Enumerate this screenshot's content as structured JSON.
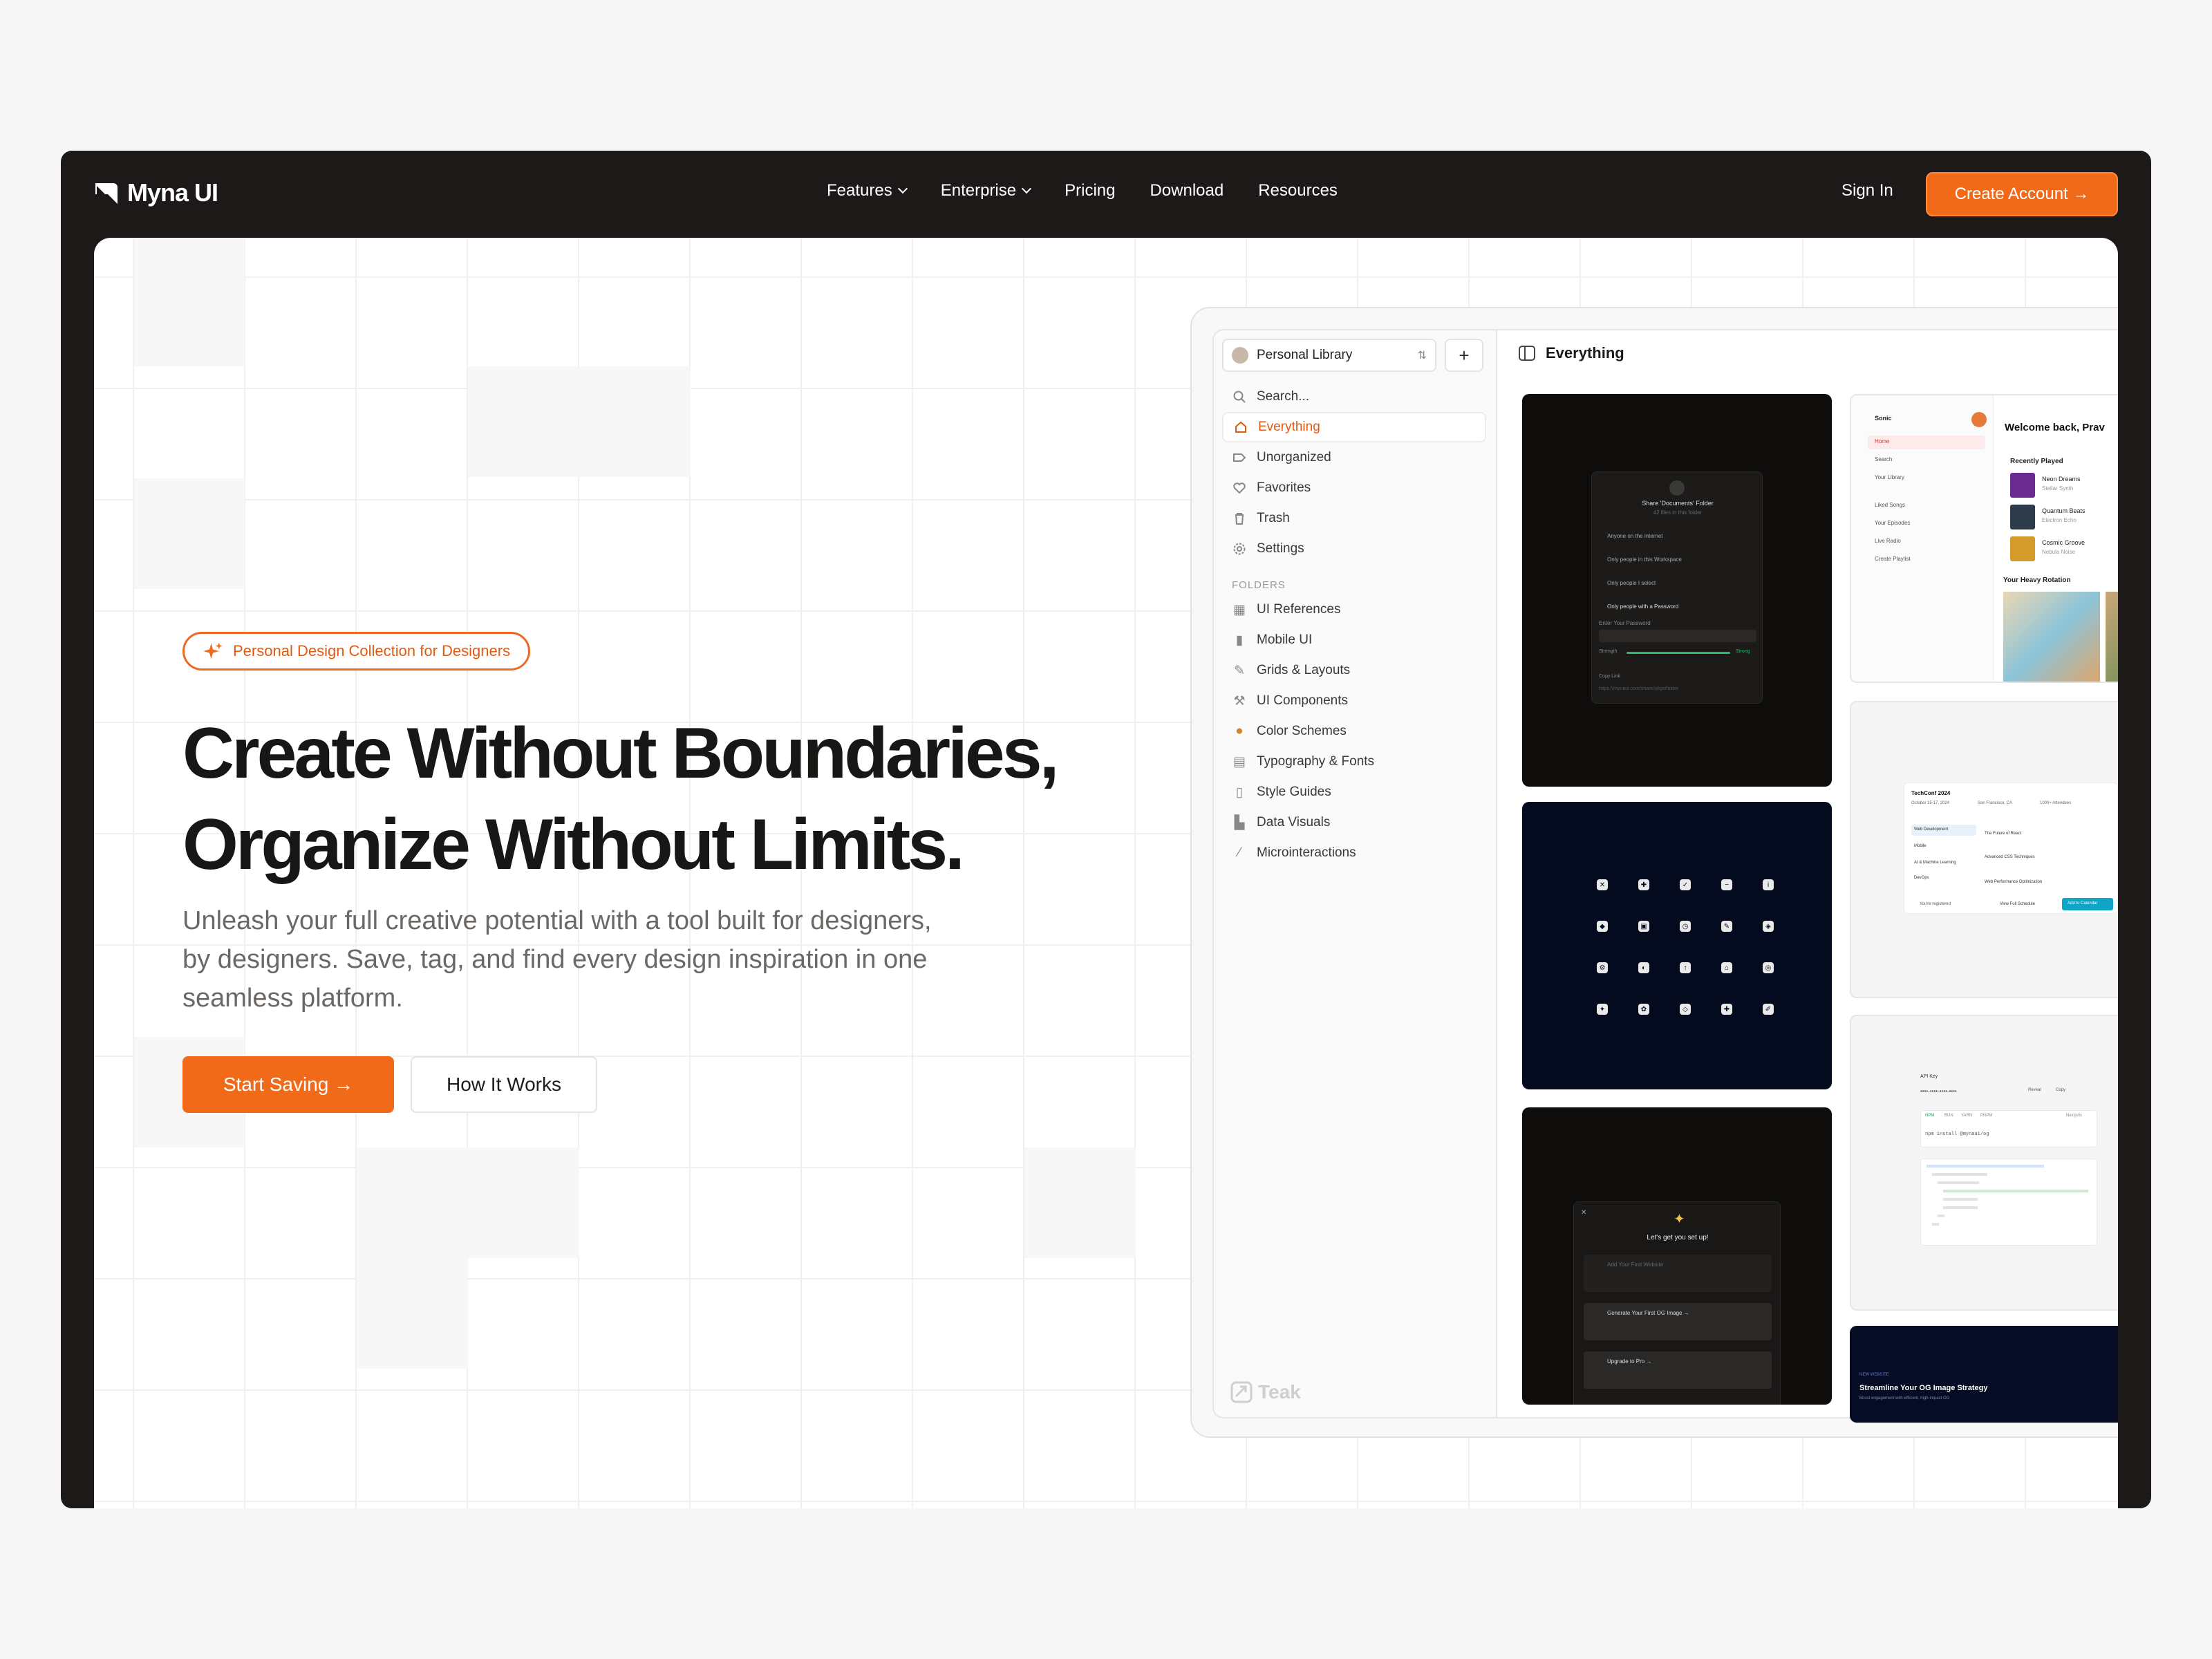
{
  "nav": {
    "brand": "Myna UI",
    "menu": [
      "Features",
      "Enterprise",
      "Pricing",
      "Download",
      "Resources"
    ],
    "sign_in": "Sign In",
    "create_account": "Create Account →"
  },
  "hero": {
    "badge": "Personal Design Collection for Designers",
    "title_line1": "Create Without Boundaries,",
    "title_line2": "Organize Without Limits.",
    "subtitle": "Unleash your full creative potential with a tool built for designers, by designers. Save, tag, and find every design inspiration in one seamless platform.",
    "primary_button": "Start Saving →",
    "secondary_button": "How It Works"
  },
  "app": {
    "library": "Personal Library",
    "search_placeholder": "Search...",
    "items": [
      "Everything",
      "Unorganized",
      "Favorites",
      "Trash",
      "Settings"
    ],
    "folders_heading": "FOLDERS",
    "folders": [
      "UI References",
      "Mobile UI",
      "Grids & Layouts",
      "UI Components",
      "Color Schemes",
      "Typography & Fonts",
      "Style Guides",
      "Data Visuals",
      "Microinteractions"
    ],
    "brand": "Teak",
    "main_title": "Everything",
    "cards": {
      "share": {
        "title": "Share 'Documents' Folder",
        "subtitle": "42 files in this folder",
        "options": [
          "Anyone on the internet",
          "Only people in this Workspace",
          "Only people I select",
          "Only people with a Password"
        ],
        "password_label": "Enter Your Password",
        "strength": "Strength",
        "strong": "Strong",
        "copy_link": "Copy Link",
        "url": "https://mynaui.com/share/a8ge/folder"
      },
      "music": {
        "brand": "Sonic",
        "welcome": "Welcome back, Prav",
        "nav": [
          "Home",
          "Search",
          "Your Library",
          "Liked Songs",
          "Your Episodes",
          "Live Radio",
          "Create Playlist"
        ],
        "recent": "Recently Played",
        "tracks": [
          {
            "name": "Neon Dreams",
            "artist": "Stellar Synth"
          },
          {
            "name": "Quantum Beats",
            "artist": "Electron Echo"
          },
          {
            "name": "Cosmic Groove",
            "artist": "Nebula Noise"
          }
        ],
        "rotation": "Your Heavy Rotation"
      },
      "conf": {
        "title": "TechConf 2024",
        "date": "October 15-17, 2024",
        "place": "San Francisco, CA",
        "count": "1000+ Attendees",
        "tracks": [
          "Web Development",
          "Mobile",
          "AI & Machine Learning",
          "DevOps"
        ],
        "talks": [
          "The Future of React",
          "Advanced CSS Techniques",
          "Web Performance Optimization"
        ],
        "registered": "You're registered",
        "schedule": "View Full Schedule",
        "add": "Add to Calendar"
      },
      "setup": {
        "title": "Let's get you set up!",
        "steps": [
          "Add Your First Website",
          "Generate Your First OG Image →",
          "Upgrade to Pro →"
        ]
      },
      "api": {
        "label": "API Key",
        "key": "••••-••••-••••-••••",
        "reveal": "Reveal",
        "copy": "Copy",
        "tabs": [
          "NPM",
          "BUN",
          "YARN",
          "PNPM"
        ],
        "cmd": "npm install @mynaui/og",
        "docs": "Nextjs/ts"
      },
      "og": {
        "kicker": "NEW WEBSITE",
        "title": "Streamline Your OG Image Strategy",
        "subtitle": "Boost engagement with efficient, high-impact OG"
      }
    }
  },
  "colors": {
    "accent": "#f06a1a",
    "frame": "#1d1918",
    "text": "#191716"
  }
}
